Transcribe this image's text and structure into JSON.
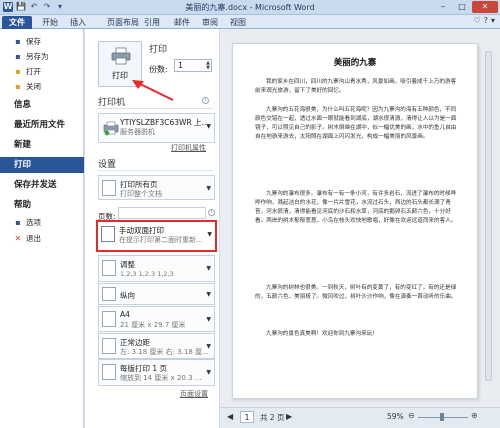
{
  "window": {
    "title": "美丽的九寨.docx - Microsoft Word",
    "quick_access": [
      "W",
      "💾",
      "↶",
      "↷",
      "▾"
    ],
    "controls": [
      "–",
      "□",
      "✕"
    ]
  },
  "ribbon_tabs": {
    "file": "文件",
    "items": [
      "开始",
      "插入",
      "页面布局",
      "引用",
      "邮件",
      "审阅",
      "视图"
    ],
    "right_icons": [
      "♡",
      "?",
      "▾"
    ]
  },
  "backstage_nav": {
    "items": [
      {
        "label": "保存",
        "icon": "save-icon",
        "glyph": "▪"
      },
      {
        "label": "另存为",
        "icon": "save-as-icon",
        "glyph": "▪"
      },
      {
        "label": "打开",
        "icon": "open-icon",
        "glyph": "▪"
      },
      {
        "label": "关闭",
        "icon": "close-doc-icon",
        "glyph": "▪"
      },
      {
        "label": "信息"
      },
      {
        "label": "最近所用文件"
      },
      {
        "label": "新建"
      },
      {
        "label": "打印",
        "active": true
      },
      {
        "label": "保存并发送"
      },
      {
        "label": "帮助"
      },
      {
        "label": "选项",
        "icon": "options-icon",
        "glyph": "▪"
      },
      {
        "label": "退出",
        "icon": "exit-icon",
        "glyph": "✕"
      }
    ]
  },
  "print_panel": {
    "section_print": "打印",
    "print_button": "打印",
    "copies_label": "份数:",
    "copies_value": "1",
    "section_printer": "打印机",
    "printer_name": "YTIYSLZBF3C63WR 上...",
    "printer_status": "服务器脱机",
    "printer_properties": "打印机属性",
    "section_settings": "设置",
    "all_pages_title": "打印所有页",
    "all_pages_sub": "打印整个文档",
    "pages_label": "页数:",
    "duplex_title": "手动双面打印",
    "duplex_sub": "在提示打印第二面时重新...",
    "collate_title": "调整",
    "collate_sub": "1,2,3    1,2,3    1,2,3",
    "orientation": "纵向",
    "paper_title": "A4",
    "paper_sub": "21 厘米 x 29.7 厘米",
    "margins_title": "正常边距",
    "margins_sub": "左: 3.18 厘米    右: 3.18 厘...",
    "zoom_title": "每版打印 1 页",
    "zoom_sub": "缩放到 14 厘米 x 20.3 ...",
    "page_setup": "页面设置"
  },
  "preview": {
    "doc_title": "美丽的九寨",
    "paragraphs": [
      "我的家乡在四川，四川的九寨沟山青水秀，风景如画，吸引着成千上万的游客前来观光旅游，留下了美好的回忆。",
      "九寨沟的五花海很美，为什么叫五花海呢？因为九寨沟的海有五种颜色，不同颜色交错在一起，透过水面一眼就能看到湖底，湖水很清澈，清得让人以为是一面镜子，可以照见自己的影子。树木倒映在湖中，似一幅优美的画，水中的鱼儿自由自在地游来游去，太阳照在湖面上闪闪发光，构成一幅美丽的风景画。",
      "九寨沟的瀑布很多。瀑布有一有一条小河，有许多岩石，流进了瀑布的时候哗哗作响，溅起洁白的水花，像一片片雪花，水流过石头，两边的石头都长满了青苔，河水很清，清得能看见河底的沙石和水草，河底的鹅卵石五颜六色，十分好看。两岸的树木郁郁葱葱，小鸟在枝头欢快地歌唱，好像在欢迎远道而来的客人。",
      "九寨沟的树林也很美。一到秋天，树叶有的变黄了，有的变红了，有的还是绿的，五颜六色，美丽极了。微风吹过，树叶沙沙作响，像在演奏一首动听的乐曲。",
      "九寨沟的景色真美啊！欢迎你到九寨沟来玩！"
    ]
  },
  "statusbar": {
    "prev": "◀",
    "page_number": "1",
    "page_total": "共 2 页",
    "next": "▶",
    "zoom": "59%",
    "zoom_minus": "⊖",
    "zoom_plus": "⊕"
  },
  "colors": {
    "file_tab": "#2a5699",
    "active_nav": "#2a5699",
    "highlight": "#e52a2a"
  }
}
